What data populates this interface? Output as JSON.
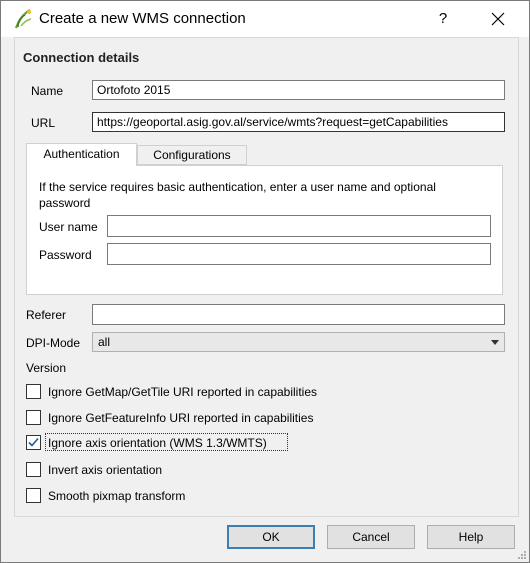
{
  "window": {
    "title": "Create a new WMS connection",
    "help_label": "?"
  },
  "group": {
    "title": "Connection details"
  },
  "name": {
    "label": "Name",
    "value": "Ortofoto 2015"
  },
  "url": {
    "label": "URL",
    "value": "https://geoportal.asig.gov.al/service/wmts?request=getCapabilities"
  },
  "tabs": [
    {
      "label": "Authentication",
      "active": true
    },
    {
      "label": "Configurations",
      "active": false
    }
  ],
  "auth": {
    "info": "If the service requires basic authentication, enter a user name and optional password",
    "username_label": "User name",
    "username_value": "",
    "password_label": "Password",
    "password_value": ""
  },
  "referer": {
    "label": "Referer",
    "value": ""
  },
  "dpi": {
    "label": "DPI-Mode",
    "selected": "all"
  },
  "version_label": "Version",
  "checkboxes": [
    {
      "label": "Ignore GetMap/GetTile URI reported in capabilities",
      "checked": false
    },
    {
      "label": "Ignore GetFeatureInfo URI reported in capabilities",
      "checked": false
    },
    {
      "label": "Ignore axis orientation (WMS 1.3/WMTS)",
      "checked": true
    },
    {
      "label": "Invert axis orientation",
      "checked": false
    },
    {
      "label": "Smooth pixmap transform",
      "checked": false
    }
  ],
  "buttons": {
    "ok": "OK",
    "cancel": "Cancel",
    "help": "Help"
  },
  "colors": {
    "accent": "#3c7fb1",
    "check": "#1e5a9c"
  }
}
